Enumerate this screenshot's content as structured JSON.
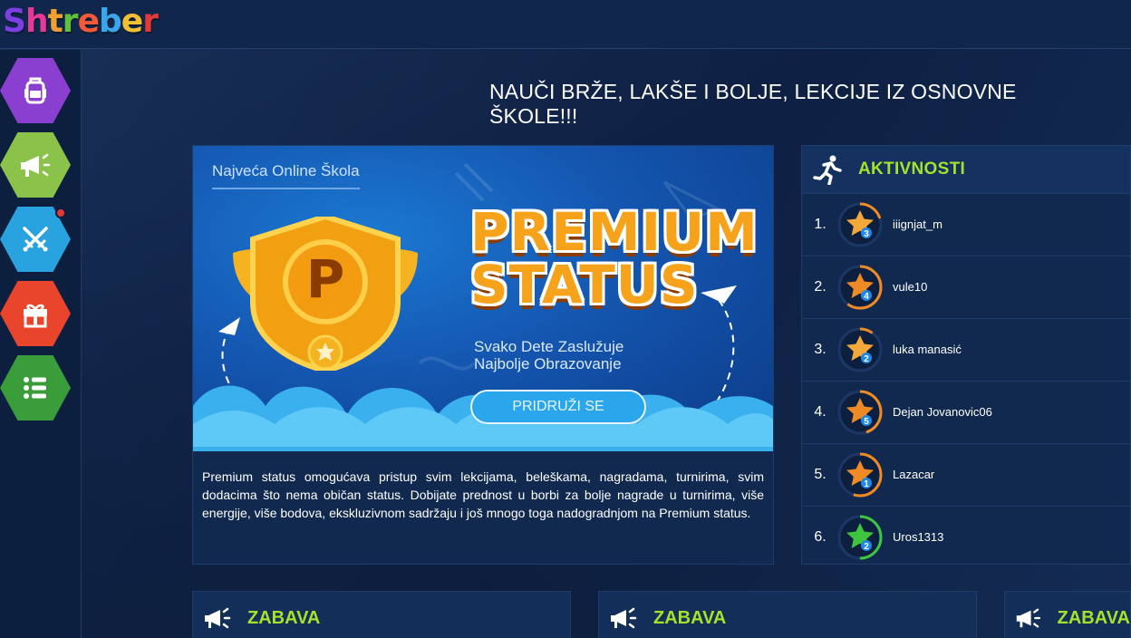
{
  "app": {
    "logo_letters": [
      {
        "ch": "S",
        "color": "#7b3fe4"
      },
      {
        "ch": "h",
        "color": "#e53995"
      },
      {
        "ch": "t",
        "color": "#f0a030"
      },
      {
        "ch": "r",
        "color": "#5fbf3a"
      },
      {
        "ch": "e",
        "color": "#f25a3a"
      },
      {
        "ch": "b",
        "color": "#3aa5e8"
      },
      {
        "ch": "e",
        "color": "#f0c030"
      },
      {
        "ch": "r",
        "color": "#e53935"
      }
    ]
  },
  "sidebar": {
    "items": [
      {
        "name": "backpack-icon",
        "color": "#8a3fd1"
      },
      {
        "name": "megaphone-icon",
        "color": "#8bc34a"
      },
      {
        "name": "swords-icon",
        "color": "#29a3e0",
        "has_notification": true
      },
      {
        "name": "gift-icon",
        "color": "#e8452c"
      },
      {
        "name": "list-icon",
        "color": "#3a9d3a"
      }
    ]
  },
  "headline": "NAUČI BRŽE, LAKŠE I BOLJE, LEKCIJE IZ OSNOVNE ŠKOLE!!!",
  "premium": {
    "tag": "Najveća Online Škola",
    "title_line1": "PREMIUM",
    "title_line2": "STATUS",
    "subtitle_line1": "Svako Dete Zaslužuje",
    "subtitle_line2": "Najbolje Obrazovanje",
    "badge_letter": "P",
    "join_label": "PRIDRUŽI SE",
    "description": "Premium status omogućava pristup svim lekcijama, beleškama, nagradama, turnirima, svim dodacima što nema običan status. Dobijate prednost u borbi za bolje nagrade u turnirima, više energije, više bodova, ekskluzivnom sadržaju i još mnogo toga nadogradnjom na Premium status."
  },
  "aktivnosti": {
    "title": "AKTIVNOSTI",
    "rows": [
      {
        "rank": "1.",
        "user": "iiignjat_m",
        "level": "3",
        "star": "#f4a83a",
        "ring": "#f08a24",
        "progress": 0.2
      },
      {
        "rank": "2.",
        "user": "vule10",
        "level": "4",
        "star": "#f08a24",
        "ring": "#f08a24",
        "progress": 0.6
      },
      {
        "rank": "3.",
        "user": "luka manasić",
        "level": "2",
        "star": "#f4a83a",
        "ring": "#f08a24",
        "progress": 0.1
      },
      {
        "rank": "4.",
        "user": "Dejan Jovanovic06",
        "level": "5",
        "star": "#f08a24",
        "ring": "#f08a24",
        "progress": 0.45
      },
      {
        "rank": "5.",
        "user": "Lazacar",
        "level": "1",
        "star": "#f08a24",
        "ring": "#f08a24",
        "progress": 0.55
      },
      {
        "rank": "6.",
        "user": "Uros1313",
        "level": "2",
        "star": "#3ec43e",
        "ring": "#3ec43e",
        "progress": 0.5
      }
    ]
  },
  "cards": [
    {
      "title": "ZABAVA"
    },
    {
      "title": "ZABAVA"
    },
    {
      "title": "ZABAVA"
    }
  ],
  "colors": {
    "accent_green": "#a4e22b",
    "panel": "#11294f"
  }
}
